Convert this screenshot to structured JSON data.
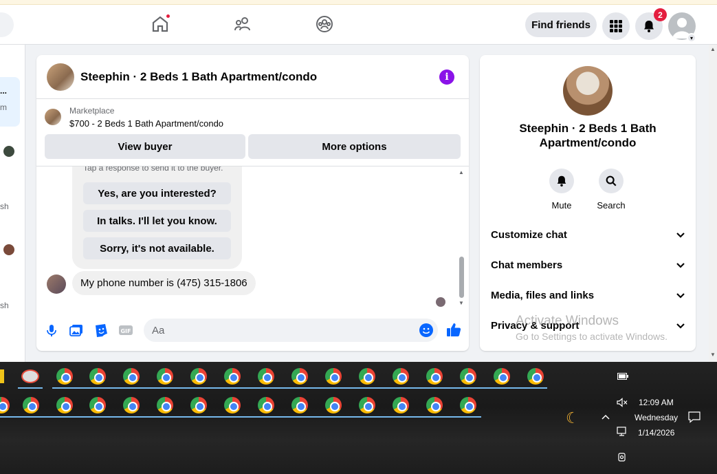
{
  "header": {
    "find_friends_label": "Find friends",
    "notification_count": "2",
    "nav": [
      "home-icon",
      "friends-icon",
      "groups-icon"
    ]
  },
  "left_fragments": [
    "...",
    "m",
    "sh",
    "sh"
  ],
  "chat": {
    "title": "Steephin · 2 Beds 1 Bath Apartment/condo",
    "marketplace_label": "Marketplace",
    "listing_price": "$700 - 2 Beds 1 Bath Apartment/condo",
    "view_buyer_label": "View buyer",
    "more_options_label": "More options",
    "auto_reply_hint": "Tap a response to send it to the buyer.",
    "quick_replies": [
      "Yes, are you interested?",
      "In talks. I'll let you know.",
      "Sorry, it's not available."
    ],
    "last_message": "My phone number is (475) 315-1806",
    "input_placeholder": "Aa"
  },
  "info_panel": {
    "name": "Steephin · 2 Beds 1 Bath Apartment/condo",
    "mute_label": "Mute",
    "search_label": "Search",
    "sections": [
      "Customize chat",
      "Chat members",
      "Media, files and links",
      "Privacy & support"
    ]
  },
  "watermark": {
    "line1": "Activate Windows",
    "line2": "Go to Settings to activate Windows."
  },
  "tray": {
    "time": "12:09 AM",
    "day": "Wednesday",
    "date": "1/14/2026"
  },
  "colors": {
    "fb_blue": "#0866ff",
    "info_purple": "#8a12e8",
    "badge_red": "#e41e3f"
  }
}
